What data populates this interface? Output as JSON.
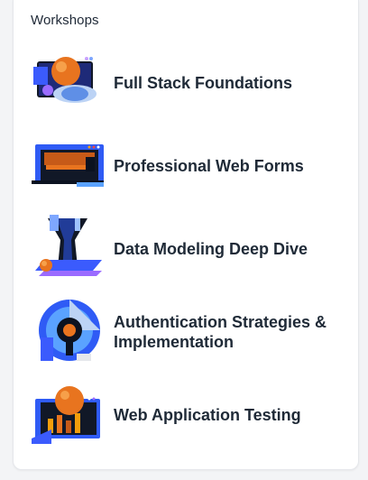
{
  "section": {
    "heading": "Workshops"
  },
  "workshops": [
    {
      "title": "Full Stack Foundations",
      "icon": "planet-orbit-icon"
    },
    {
      "title": "Professional Web Forms",
      "icon": "web-form-window-icon"
    },
    {
      "title": "Data Modeling Deep Dive",
      "icon": "data-vortex-icon"
    },
    {
      "title": "Authentication Strategies & Implementation",
      "icon": "keyhole-lock-icon"
    },
    {
      "title": "Web Application Testing",
      "icon": "test-chart-planet-icon"
    }
  ],
  "colors": {
    "accent_blue": "#2f5bf5",
    "orange": "#e8741f",
    "dark": "#111827",
    "title_text": "#1f2a37"
  }
}
